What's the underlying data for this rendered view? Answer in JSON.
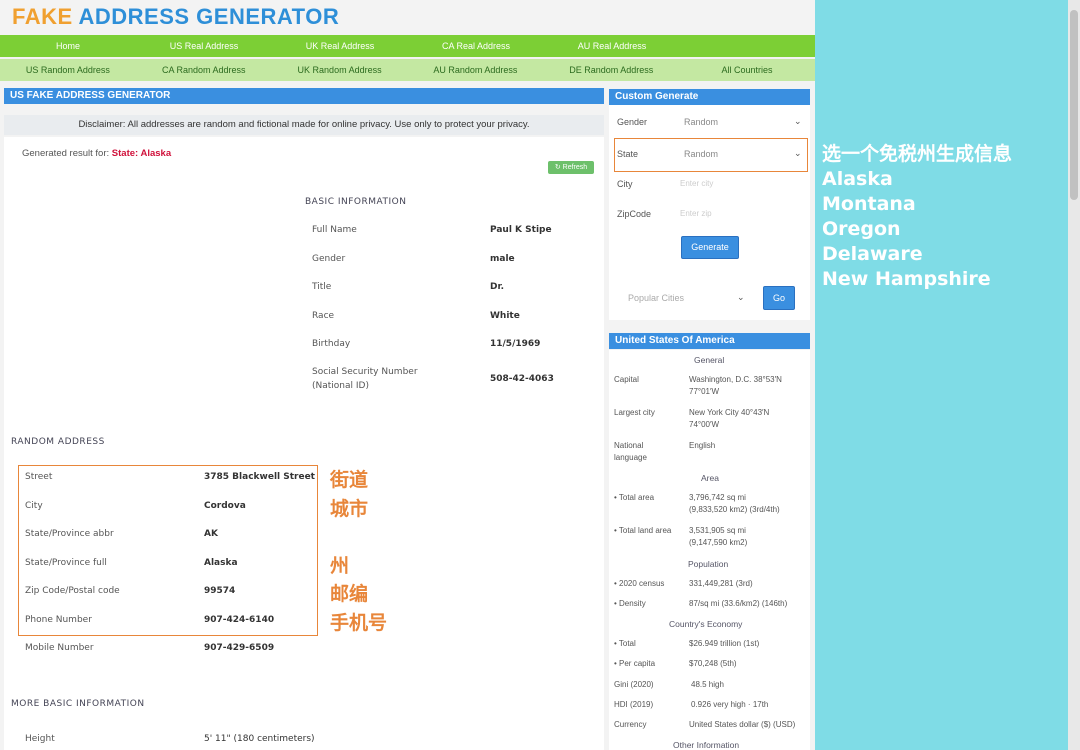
{
  "logo": {
    "part1": "FAKE",
    "part2": "ADDRESS GENERATOR"
  },
  "nav_primary": [
    "Home",
    "US Real Address",
    "UK Real Address",
    "CA Real Address",
    "AU Real Address"
  ],
  "nav_secondary": [
    "US Random Address",
    "CA Random Address",
    "UK Random Address",
    "AU Random Address",
    "DE Random Address",
    "All Countries"
  ],
  "main": {
    "header": "US FAKE ADDRESS GENERATOR",
    "disclaimer": "Disclaimer: All addresses are random and fictional made for online privacy. Use only to protect your privacy.",
    "result_label": "Generated result for:",
    "result_value": "State: Alaska",
    "refresh_label": "Refresh",
    "basic_title": "BASIC INFORMATION",
    "basic": [
      {
        "label": "Full Name",
        "value": "Paul K Stipe"
      },
      {
        "label": "Gender",
        "value": "male"
      },
      {
        "label": "Title",
        "value": "Dr."
      },
      {
        "label": "Race",
        "value": "White"
      },
      {
        "label": "Birthday",
        "value": "11/5/1969"
      },
      {
        "label": "Social Security Number",
        "label2": "(National ID)",
        "value": "508-42-4063"
      }
    ],
    "random_title": "RANDOM ADDRESS",
    "address": [
      {
        "label": "Street",
        "value": "3785 Blackwell Street"
      },
      {
        "label": "City",
        "value": "Cordova"
      },
      {
        "label": "State/Province abbr",
        "value": "AK"
      },
      {
        "label": "State/Province full",
        "value": "Alaska"
      },
      {
        "label": "Zip Code/Postal code",
        "value": "99574"
      },
      {
        "label": "Phone Number",
        "value": "907-424-6140"
      },
      {
        "label": "Mobile Number",
        "value": "907-429-6509"
      }
    ],
    "more_title": "MORE BASIC INFORMATION",
    "more": [
      {
        "label": "Height",
        "value": "5' 11\" (180 centimeters)"
      }
    ]
  },
  "notes": {
    "street": "街道",
    "city": "城市",
    "state": "州",
    "zip": "邮编",
    "phone": "手机号"
  },
  "custom": {
    "header": "Custom Generate",
    "gender_label": "Gender",
    "gender_value": "Random",
    "state_label": "State",
    "state_value": "Random",
    "city_label": "City",
    "city_placeholder": "Enter city",
    "zip_label": "ZipCode",
    "zip_placeholder": "Enter zip",
    "generate_label": "Generate",
    "popular_placeholder": "Popular Cities",
    "go_label": "Go"
  },
  "country": {
    "header": "United States Of America",
    "general": "General",
    "capital_label": "Capital",
    "capital_l1": "Washington, D.C. 38°53′N",
    "capital_l2": "77°01′W",
    "largest_label": "Largest city",
    "largest_l1": "New York City 40°43′N",
    "largest_l2": "74°00′W",
    "lang_label1": "National",
    "lang_label2": "language",
    "lang_value": "English",
    "area_head": "Area",
    "total_area_label": "• Total area",
    "total_area_l1": "3,796,742 sq mi",
    "total_area_l2": "(9,833,520 km2) (3rd/4th)",
    "land_area_label": "• Total land area",
    "land_area_l1": "3,531,905 sq mi",
    "land_area_l2": "(9,147,590 km2)",
    "pop_head": "Population",
    "census_label": "• 2020 census",
    "census_value": "331,449,281 (3rd)",
    "density_label": "• Density",
    "density_value": "87/sq mi (33.6/km2) (146th)",
    "econ_head": "Country's Economy",
    "total_label": "• Total",
    "total_value": "$26.949 trillion (1st)",
    "percap_label": "• Per capita",
    "percap_value": "$70,248 (5th)",
    "gini_label": "Gini (2020)",
    "gini_value": "48.5 high",
    "hdi_label": "HDI (2019)",
    "hdi_value": "0.926 very high · 17th",
    "currency_label": "Currency",
    "currency_value": "United States dollar ($) (USD)",
    "other_head": "Other Information"
  },
  "annotation": {
    "title": "选一个免税州生成信息",
    "states": [
      "Alaska",
      "Montana",
      "Oregon",
      "Delaware",
      "New Hampshire"
    ]
  },
  "colors": {
    "accent": "#3a8fe0",
    "nav_green": "#7ccf35",
    "nav_light": "#c4e8a2",
    "highlight": "#e8863a",
    "result_red": "#d0103a",
    "backdrop": "#7fdce6"
  }
}
